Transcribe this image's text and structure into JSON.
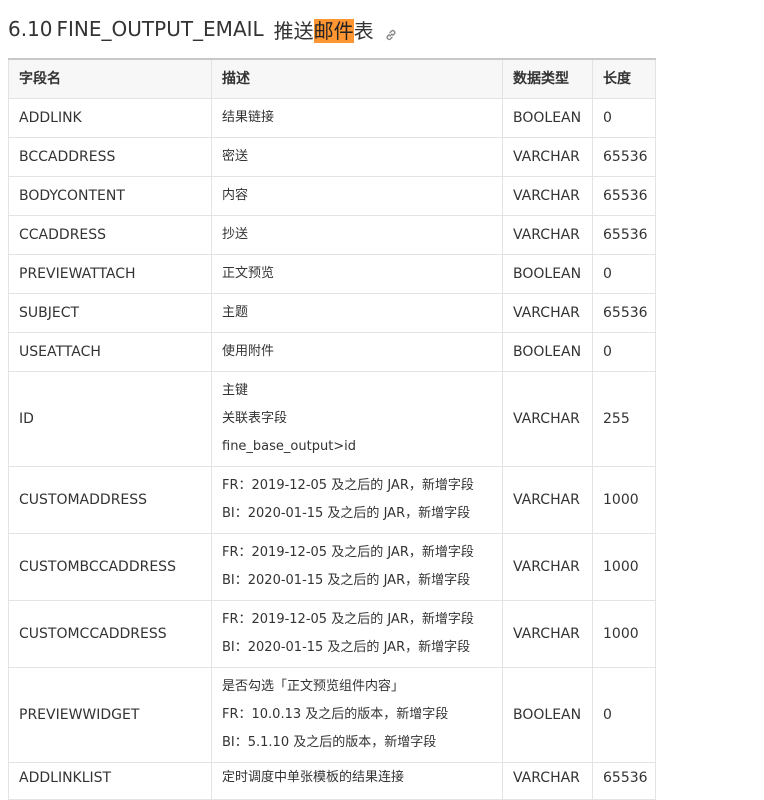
{
  "heading": {
    "number": "6.10",
    "name": "FINE_OUTPUT_EMAIL",
    "cn_prefix": "推送",
    "cn_highlight": "邮件",
    "cn_suffix": "表",
    "link_icon": "link-icon"
  },
  "table": {
    "headers": [
      "字段名",
      "描述",
      "数据类型",
      "长度"
    ],
    "rows": [
      {
        "name": "ADDLINK",
        "desc": [
          "结果链接"
        ],
        "type": "BOOLEAN",
        "length": "0"
      },
      {
        "name": "BCCADDRESS",
        "desc": [
          "密送"
        ],
        "type": "VARCHAR",
        "length": "65536"
      },
      {
        "name": "BODYCONTENT",
        "desc": [
          "内容"
        ],
        "type": "VARCHAR",
        "length": "65536"
      },
      {
        "name": "CCADDRESS",
        "desc": [
          "抄送"
        ],
        "type": "VARCHAR",
        "length": "65536"
      },
      {
        "name": "PREVIEWATTACH",
        "desc": [
          "正文预览"
        ],
        "type": "BOOLEAN",
        "length": "0"
      },
      {
        "name": "SUBJECT",
        "desc": [
          "主题"
        ],
        "type": "VARCHAR",
        "length": "65536"
      },
      {
        "name": "USEATTACH",
        "desc": [
          "使用附件"
        ],
        "type": "BOOLEAN",
        "length": "0"
      },
      {
        "name": "ID",
        "desc": [
          "主键",
          "关联表字段",
          "fine_base_output>id"
        ],
        "type": "VARCHAR",
        "length": "255"
      },
      {
        "name": "CUSTOMADDRESS",
        "desc": [
          "FR：2019-12-05 及之后的 JAR，新增字段",
          "BI：2020-01-15 及之后的 JAR，新增字段"
        ],
        "type": "VARCHAR",
        "length": "1000"
      },
      {
        "name": "CUSTOMBCCADDRESS",
        "desc": [
          "FR：2019-12-05 及之后的 JAR，新增字段",
          "BI：2020-01-15 及之后的 JAR，新增字段"
        ],
        "type": "VARCHAR",
        "length": "1000"
      },
      {
        "name": "CUSTOMCCADDRESS",
        "desc": [
          "FR：2019-12-05 及之后的 JAR，新增字段",
          "BI：2020-01-15 及之后的 JAR，新增字段"
        ],
        "type": "VARCHAR",
        "length": "1000"
      },
      {
        "name": "PREVIEWWIDGET",
        "desc": [
          "是否勾选「正文预览组件内容」",
          "FR：10.0.13 及之后的版本，新增字段",
          "BI：5.1.10 及之后的版本，新增字段"
        ],
        "type": "BOOLEAN",
        "length": "0"
      },
      {
        "name": "ADDLINKLIST",
        "desc": [
          "定时调度中单张模板的结果连接"
        ],
        "type": "VARCHAR",
        "length": "65536"
      }
    ]
  }
}
